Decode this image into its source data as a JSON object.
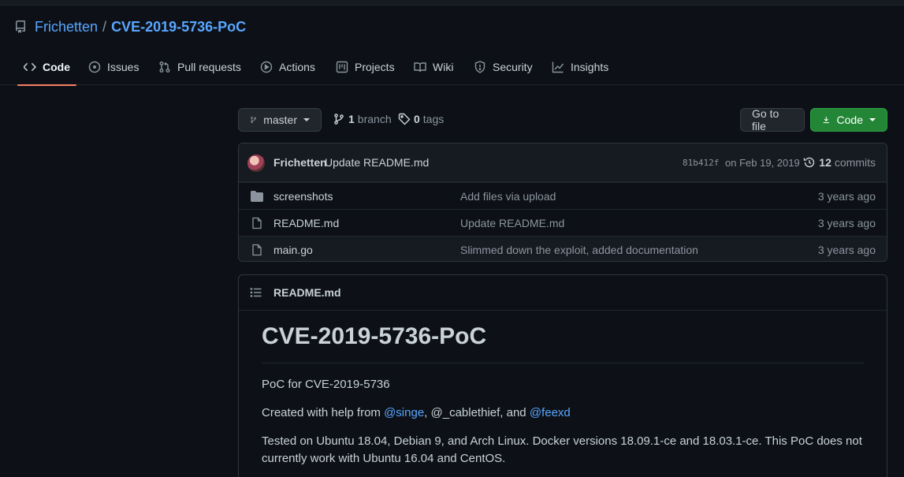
{
  "repo": {
    "owner": "Frichetten",
    "separator": "/",
    "name": "CVE-2019-5736-PoC"
  },
  "tabs": [
    {
      "label": "Code",
      "icon": "code-icon"
    },
    {
      "label": "Issues",
      "icon": "issue-icon"
    },
    {
      "label": "Pull requests",
      "icon": "pull-request-icon"
    },
    {
      "label": "Actions",
      "icon": "play-icon"
    },
    {
      "label": "Projects",
      "icon": "project-icon"
    },
    {
      "label": "Wiki",
      "icon": "book-icon"
    },
    {
      "label": "Security",
      "icon": "shield-icon"
    },
    {
      "label": "Insights",
      "icon": "graph-icon"
    }
  ],
  "toolbar": {
    "branch": "master",
    "branch_count": "1",
    "branch_label": "branch",
    "tag_count": "0",
    "tag_label": "tags",
    "go_to_file": "Go to file",
    "code_button": "Code"
  },
  "commit": {
    "author": "Frichetten",
    "message": "Update README.md",
    "hash": "81b412f",
    "date": "on Feb 19, 2019",
    "count": "12",
    "count_label": "commits"
  },
  "files": [
    {
      "name": "screenshots",
      "type": "folder",
      "commit": "Add files via upload",
      "age": "3 years ago"
    },
    {
      "name": "README.md",
      "type": "file",
      "commit": "Update README.md",
      "age": "3 years ago"
    },
    {
      "name": "main.go",
      "type": "file",
      "commit": "Slimmed down the exploit, added documentation",
      "age": "3 years ago"
    }
  ],
  "readme": {
    "filename": "README.md",
    "title": "CVE-2019-5736-PoC",
    "p1": "PoC for CVE-2019-5736",
    "p2_prefix": "Created with help from ",
    "mention1": "@singe",
    "p2_mid": ", @_cablethief, and ",
    "mention2": "@feexd",
    "p3": "Tested on Ubuntu 18.04, Debian 9, and Arch Linux. Docker versions 18.09.1-ce and 18.03.1-ce. This PoC does not currently work with Ubuntu 16.04 and CentOS."
  },
  "colors": {
    "background": "#0d1117",
    "accent_link": "#58a6ff",
    "active_tab_underline": "#f78166",
    "primary_button": "#238636"
  }
}
